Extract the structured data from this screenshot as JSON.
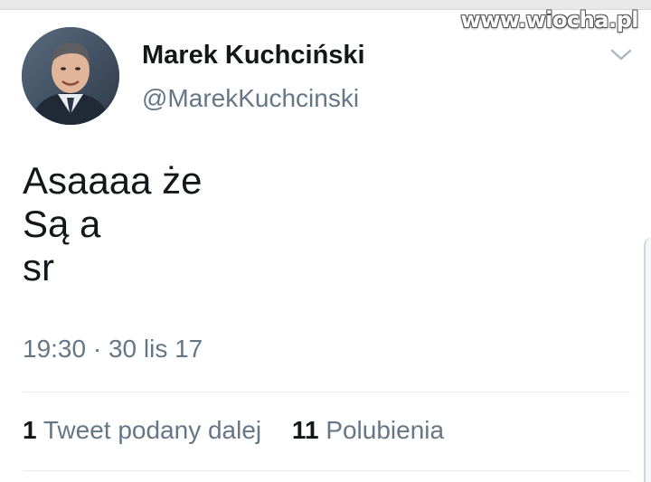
{
  "watermark": "www.wiocha.pl",
  "tweet": {
    "display_name": "Marek Kuchciński",
    "handle": "@MarekKuchcinski",
    "text_lines": [
      "Asaaaa że",
      "Są a",
      "sr"
    ],
    "timestamp": "19:30 · 30 lis 17",
    "retweets_count": "1",
    "retweets_label": "Tweet podany dalej",
    "likes_count": "11",
    "likes_label": "Polubienia"
  },
  "icons": {
    "avatar": "profile-photo",
    "chevron": "chevron-down-icon"
  },
  "colors": {
    "primary_text": "#14171a",
    "secondary_text": "#657786",
    "divider": "#e6ecf0"
  }
}
